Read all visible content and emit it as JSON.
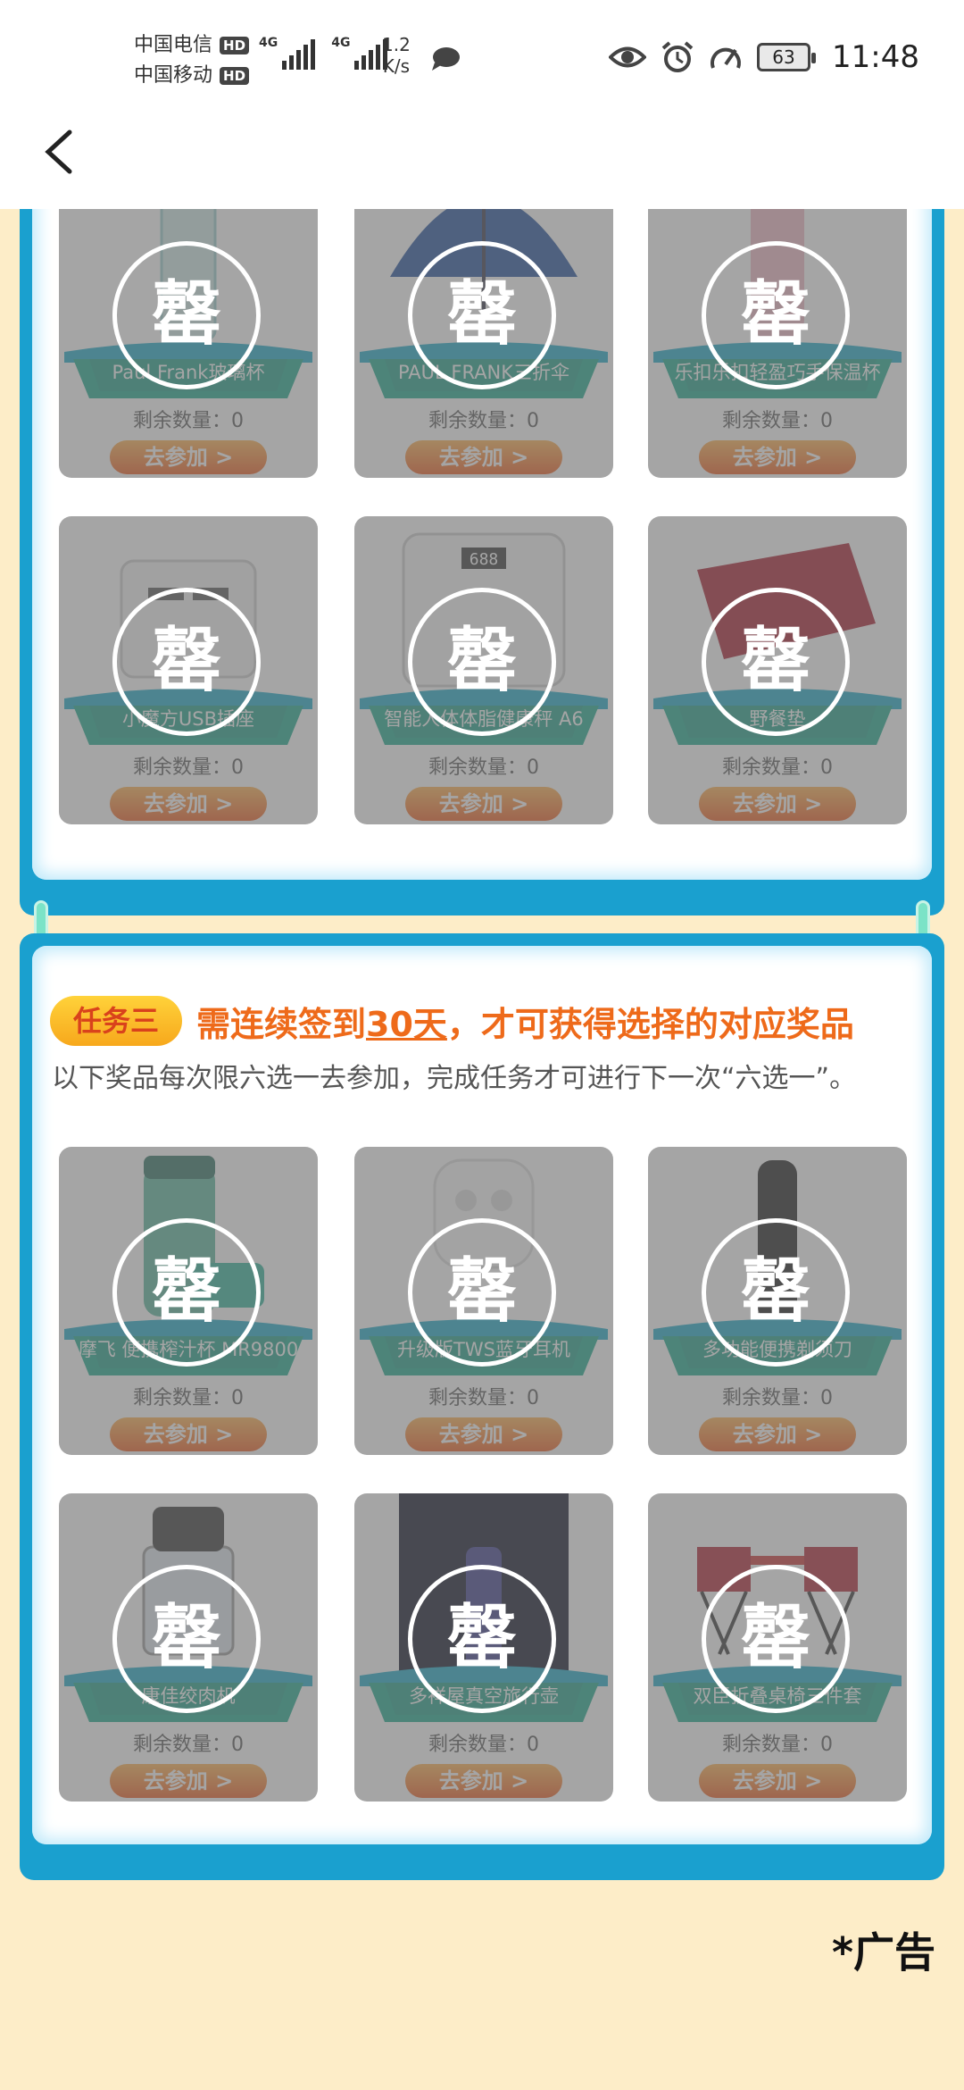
{
  "status_bar": {
    "carrier1": "中国电信",
    "carrier2": "中国移动",
    "hd": "HD",
    "net1": "4G",
    "net2": "4G",
    "speed_value": "1.2",
    "speed_unit": "K/s",
    "battery": "63",
    "time": "11:48"
  },
  "seal_char": "罄",
  "remain_label": "剩余数量：0",
  "join_label": "去参加 >",
  "section1": {
    "prizes": [
      {
        "name": "Paul Frank玻璃杯",
        "icon": "glass-cup"
      },
      {
        "name": "PAUL FRANK三折伞",
        "icon": "umbrella"
      },
      {
        "name": "乐扣乐扣轻盈巧手保温杯",
        "icon": "thermos"
      },
      {
        "name": "小魔方USB插座",
        "icon": "usb-socket"
      },
      {
        "name": "智能人体体脂健康秤 A6",
        "icon": "scale"
      },
      {
        "name": "野餐垫",
        "icon": "picnic-mat"
      }
    ]
  },
  "section2": {
    "badge": "任务三",
    "title_prefix": "需连续签到",
    "title_days": "30天",
    "title_suffix": "，才可获得选择的对应奖品",
    "desc": "以下奖品每次限六选一去参加，完成任务才可进行下一次“六选一”。",
    "prizes": [
      {
        "name": "摩飞 便携榨汁杯 MR9800",
        "icon": "juicer"
      },
      {
        "name": "升级版TWS蓝牙耳机",
        "icon": "earbuds"
      },
      {
        "name": "多功能便携剃须刀",
        "icon": "shaver"
      },
      {
        "name": "康佳绞肉机",
        "icon": "meat-grinder"
      },
      {
        "name": "多祥屋真空旅行壶",
        "icon": "travel-flask"
      },
      {
        "name": "双臣折叠桌椅三件套",
        "icon": "folding-chairs"
      }
    ]
  },
  "ad_label": "*广告"
}
